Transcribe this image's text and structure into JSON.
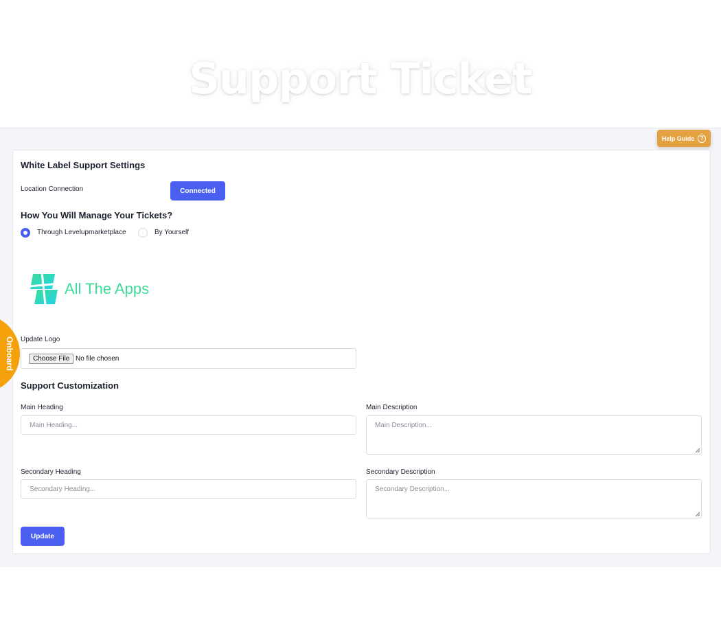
{
  "hero": {
    "title": "Support Ticket"
  },
  "help_guide": {
    "label": "Help Guide",
    "icon": "?"
  },
  "settings": {
    "title": "White Label Support Settings",
    "location_label": "Location Connection",
    "connected_label": "Connected",
    "manage_title": "How You Will Manage Your Tickets?",
    "options": [
      {
        "label": "Through Levelupmarketplace",
        "selected": true
      },
      {
        "label": "By Yourself",
        "selected": false
      }
    ]
  },
  "logo": {
    "text": "All The Apps",
    "color": "#3ddc97"
  },
  "update_logo": {
    "label": "Update Logo",
    "button": "Choose File",
    "status": "No file chosen"
  },
  "customization": {
    "title": "Support Customization",
    "main_heading": {
      "label": "Main Heading",
      "placeholder": "Main Heading..."
    },
    "main_description": {
      "label": "Main Description",
      "placeholder": "Main Description..."
    },
    "secondary_heading": {
      "label": "Secondary Heading",
      "placeholder": "Secondary Heading..."
    },
    "secondary_description": {
      "label": "Secondary Description",
      "placeholder": "Secondary Description..."
    },
    "update_button": "Update"
  },
  "onboard": {
    "label": "Onboard"
  },
  "colors": {
    "primary": "#4a5ff0",
    "help": "#e3a23f",
    "onboard": "#f4a10b"
  }
}
